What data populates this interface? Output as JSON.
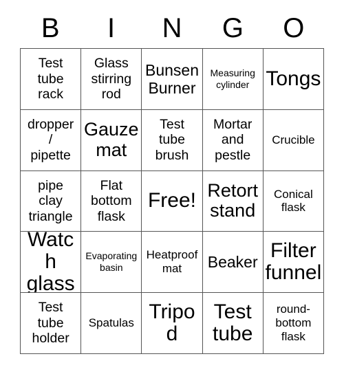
{
  "header": {
    "letters": [
      "B",
      "I",
      "N",
      "G",
      "O"
    ]
  },
  "grid": {
    "columns": 5,
    "rows": 5,
    "free_space_label": "Free!",
    "cells": [
      {
        "text": "Test\ntube\nrack",
        "size": "m"
      },
      {
        "text": "Glass\nstirring\nrod",
        "size": "m"
      },
      {
        "text": "Bunsen\nBurner",
        "size": "l"
      },
      {
        "text": "Measuring\ncylinder",
        "size": "xs"
      },
      {
        "text": "Tongs",
        "size": "xxl"
      },
      {
        "text": "dropper\n/\npipette",
        "size": "m"
      },
      {
        "text": "Gauze\nmat",
        "size": "xl"
      },
      {
        "text": "Test\ntube\nbrush",
        "size": "m"
      },
      {
        "text": "Mortar\nand\npestle",
        "size": "m"
      },
      {
        "text": "Crucible",
        "size": "s"
      },
      {
        "text": "pipe\nclay\ntriangle",
        "size": "m"
      },
      {
        "text": "Flat\nbottom\nflask",
        "size": "m"
      },
      {
        "text": "Free!",
        "size": "xxl"
      },
      {
        "text": "Retort\nstand",
        "size": "xl"
      },
      {
        "text": "Conical\nflask",
        "size": "s"
      },
      {
        "text": "Watch\nglass",
        "size": "xxl"
      },
      {
        "text": "Evaporating\nbasin",
        "size": "xs"
      },
      {
        "text": "Heatproof\nmat",
        "size": "s"
      },
      {
        "text": "Beaker",
        "size": "l"
      },
      {
        "text": "Filter\nfunnel",
        "size": "xxl"
      },
      {
        "text": "Test\ntube\nholder",
        "size": "m"
      },
      {
        "text": "Spatulas",
        "size": "s"
      },
      {
        "text": "Tripod",
        "size": "xxl"
      },
      {
        "text": "Test\ntube",
        "size": "xxl"
      },
      {
        "text": "round-\nbottom\nflask",
        "size": "s"
      }
    ]
  },
  "colors": {
    "background": "#ffffff",
    "text": "#000000",
    "border": "#555555"
  }
}
